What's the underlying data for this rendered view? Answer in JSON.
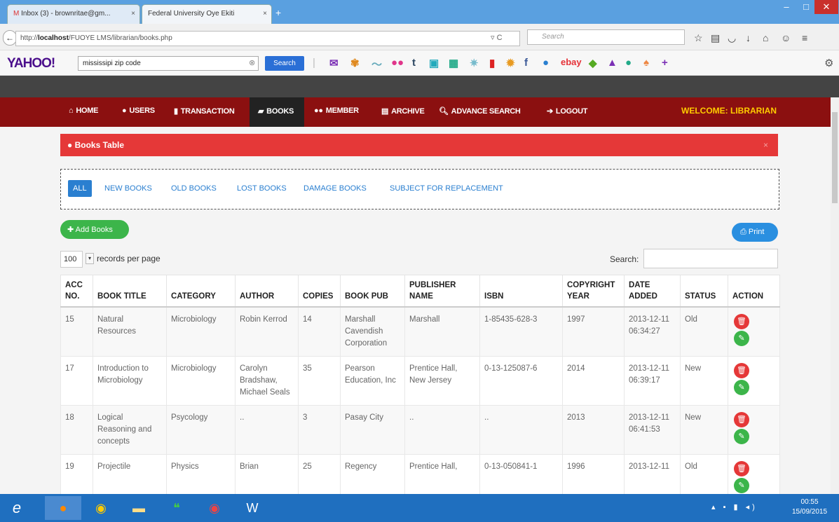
{
  "browser": {
    "tabs": [
      {
        "label": "Inbox (3) - brownritae@gm...",
        "close": "×"
      },
      {
        "label": "Federal University Oye Ekiti",
        "close": "×"
      }
    ],
    "new_tab": "+",
    "url_prefix": "http://",
    "url_host": "localhost",
    "url_path": "/FUOYE LMS/librarian/books.php",
    "search_placeholder": "Search",
    "window_buttons": {
      "minimize": "–",
      "maximize": "□",
      "close": "✕"
    }
  },
  "yahoo": {
    "logo": "YAHOO!",
    "query": "mississipi zip code",
    "search_label": "Search",
    "toolbar_icons": [
      "mail-icon",
      "game-icon",
      "weather-icon",
      "flickr-icon",
      "tumblr-icon",
      "chat-icon",
      "news-icon",
      "celebrity-icon",
      "bookmark-icon",
      "settings-icon",
      "facebook-icon",
      "music-icon",
      "ebay-icon",
      "tag-icon",
      "sports-icon",
      "finance-icon",
      "shopping-icon",
      "add-icon"
    ],
    "ebay_label": "ebay",
    "tumblr_label": "t"
  },
  "nav": {
    "items": [
      {
        "label": "HOME",
        "icon": "home-icon"
      },
      {
        "label": "USERS",
        "icon": "user-icon"
      },
      {
        "label": "TRANSACTION",
        "icon": "document-icon"
      },
      {
        "label": "BOOKS",
        "icon": "book-icon"
      },
      {
        "label": "MEMBER",
        "icon": "group-icon"
      },
      {
        "label": "ARCHIVE",
        "icon": "archive-icon"
      },
      {
        "label": "ADVANCE SEARCH",
        "icon": "search-icon"
      },
      {
        "label": "LOGOUT",
        "icon": "logout-icon"
      }
    ],
    "welcome": "WELCOME: LIBRARIAN"
  },
  "panel": {
    "title": "Books Table",
    "close": "×"
  },
  "filters": [
    "ALL",
    "NEW BOOKS",
    "OLD BOOKS",
    "LOST BOOKS",
    "DAMAGE BOOKS",
    "SUBJECT FOR REPLACEMENT"
  ],
  "toolbar": {
    "add_label": "Add Books",
    "print_label": "Print"
  },
  "paging": {
    "per_page": "100",
    "records_label": "records per page",
    "search_label": "Search:"
  },
  "table": {
    "headers": [
      "ACC NO.",
      "BOOK TITLE",
      "CATEGORY",
      "AUTHOR",
      "COPIES",
      "BOOK PUB",
      "PUBLISHER NAME",
      "ISBN",
      "COPYRIGHT YEAR",
      "DATE ADDED",
      "STATUS",
      "ACTION"
    ],
    "rows": [
      [
        "15",
        "Natural Resources",
        "Microbiology",
        "Robin Kerrod",
        "14",
        "Marshall Cavendish Corporation",
        "Marshall",
        "1-85435-628-3",
        "1997",
        "2013-12-11 06:34:27",
        "Old"
      ],
      [
        "17",
        "Introduction to Microbiology",
        "Microbiology",
        "Carolyn Bradshaw, Michael Seals",
        "35",
        "Pearson Education, Inc",
        "Prentice Hall, New Jersey",
        "0-13-125087-6",
        "2014",
        "2013-12-11 06:39:17",
        "New"
      ],
      [
        "18",
        "Logical Reasoning and concepts",
        "Psycology",
        "..",
        "3",
        "Pasay City",
        "..",
        "..",
        "2013",
        "2013-12-11 06:41:53",
        "New"
      ],
      [
        "19",
        "Projectile",
        "Physics",
        "Brian",
        "25",
        "Regency",
        "Prentice Hall,",
        "0-13-050841-1",
        "1996",
        "2013-12-11",
        "Old"
      ]
    ]
  },
  "taskbar": {
    "apps": [
      "ie-icon",
      "firefox-icon",
      "chrome-icon",
      "explorer-icon",
      "hangouts-icon",
      "chrome-alt-icon",
      "word-icon"
    ],
    "time": "00:55",
    "date": "15/09/2015"
  }
}
